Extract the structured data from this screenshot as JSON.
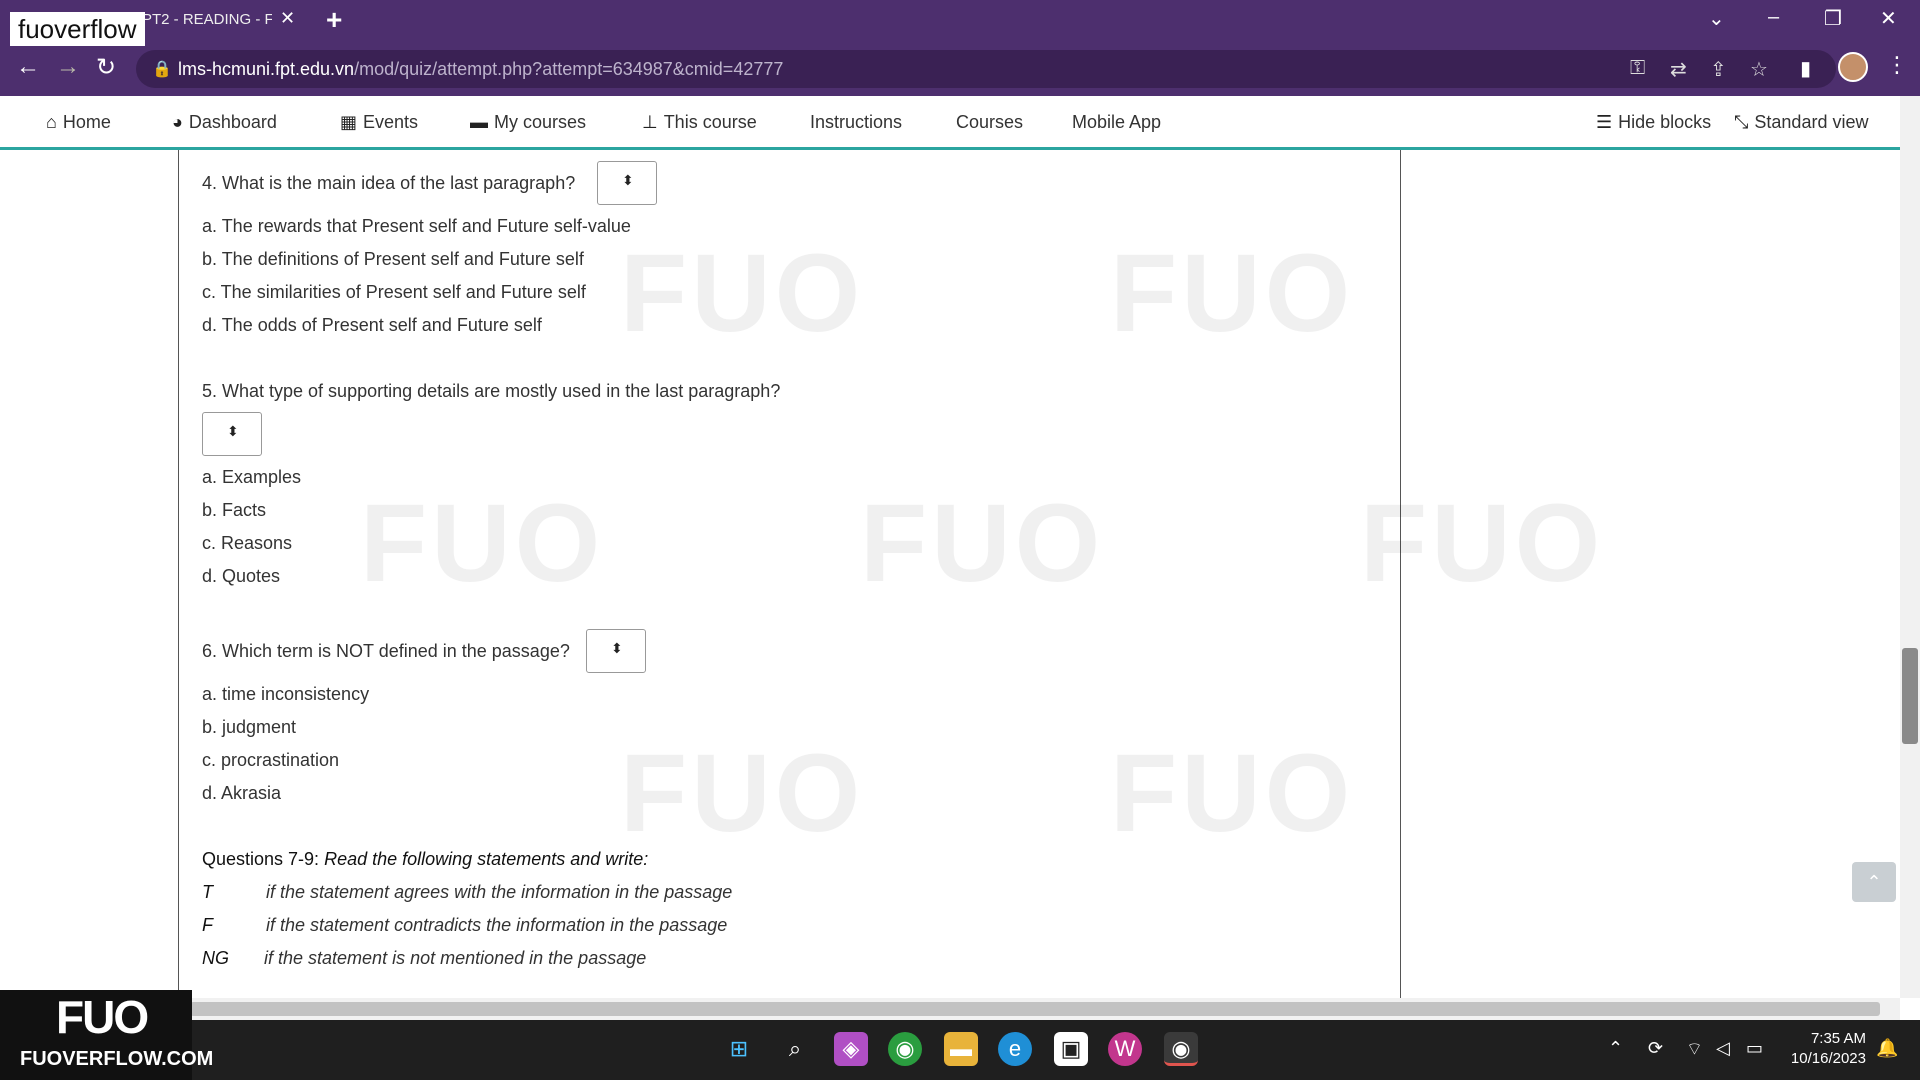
{
  "browser": {
    "badge": "fuoverflow",
    "tab_title": "PT2 - READING - F/",
    "tab_close": "✕",
    "new_tab": "+",
    "url_host": "lms-hcmuni.fpt.edu.vn",
    "url_path": "/mod/quiz/attempt.php?attempt=634987&cmid=42777"
  },
  "nav": {
    "home": "Home",
    "dashboard": "Dashboard",
    "events": "Events",
    "my_courses": "My courses",
    "this_course": "This course",
    "instructions": "Instructions",
    "courses": "Courses",
    "mobile_app": "Mobile App",
    "hide_blocks": "Hide blocks",
    "standard_view": "Standard view"
  },
  "questions": {
    "q4": {
      "text": "4. What is the main idea of the last paragraph?",
      "options": [
        "a. The rewards that Present self and Future self-value",
        "b. The definitions of Present self and Future self",
        "c. The similarities of Present self and Future self",
        "d. The odds of Present self and Future self"
      ]
    },
    "q5": {
      "text": "5. What type of supporting details are mostly used in the last paragraph?",
      "options": [
        "a. Examples",
        "b. Facts",
        "c. Reasons",
        "d. Quotes"
      ]
    },
    "q6": {
      "text": "6. Which term is NOT defined in the passage?",
      "options": [
        "a. time inconsistency",
        "b. judgment",
        "c. procrastination",
        "d. Akrasia"
      ]
    },
    "section": {
      "heading": "Questions 7-9:",
      "instruction": "Read the following statements and write:",
      "rows": [
        {
          "code": "T",
          "desc": "if the statement agrees with the information in the passage"
        },
        {
          "code": "F",
          "desc": "if the statement contradicts the information in the passage"
        },
        {
          "code": "NG",
          "desc": "if the statement is not mentioned in the passage"
        }
      ]
    }
  },
  "watermark": {
    "brand_mark": "FUO",
    "site": "FUOVERFLOW.COM"
  },
  "taskbar": {
    "time": "7:35 AM",
    "date": "10/16/2023"
  },
  "colors": {
    "chrome": "#4d2f6e",
    "nav_underline": "#2ba5a0"
  }
}
